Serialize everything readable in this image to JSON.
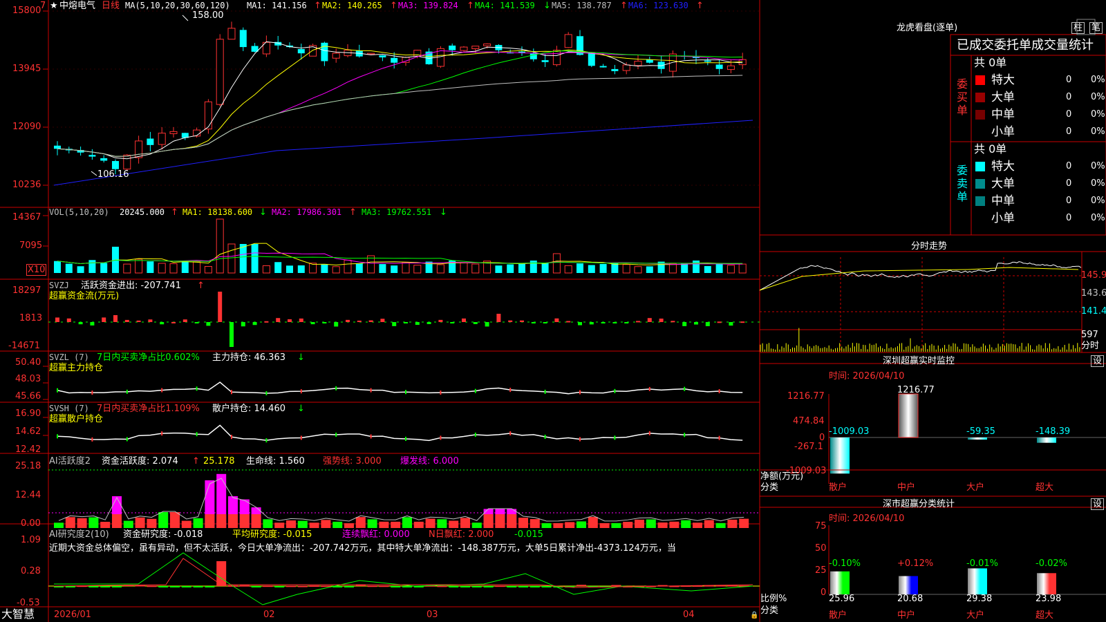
{
  "app": {
    "stock_name": "中熔电气",
    "period": "日线",
    "bottom_label": "大智慧",
    "star_glyph": "★"
  },
  "colors": {
    "up": "#ff3232",
    "down": "#00ffff",
    "ma1": "#ffffff",
    "ma2": "#ffff00",
    "ma3": "#ff00ff",
    "ma4": "#00ff00",
    "ma5": "#c0c0c0",
    "ma6": "#2020ff",
    "grid": "#cc0000",
    "axis_text": "#ff3232"
  },
  "price_panel": {
    "ma_header": "MA(5,10,20,30,60,120)",
    "ma_values": [
      {
        "label": "MA1: 141.156",
        "arrow": "↑"
      },
      {
        "label": "MA2: 140.265",
        "arrow": "↑"
      },
      {
        "label": "MA3: 139.824",
        "arrow": "↑"
      },
      {
        "label": "MA4: 141.539",
        "arrow": "↓"
      },
      {
        "label": "MA5: 138.787",
        "arrow": "↑"
      },
      {
        "label": "MA6: 123.630",
        "arrow": "↑"
      }
    ],
    "y_ticks": [
      "15800",
      "13945",
      "12090",
      "10236"
    ],
    "high_label": "158.00",
    "low_label": "106.16",
    "top_mark": "7"
  },
  "vol_panel": {
    "header": "VOL(5,10,20)",
    "value": "20245.000",
    "ma_values": [
      {
        "label": "MA1: 18138.600",
        "arrow": "↓"
      },
      {
        "label": "MA2: 17986.301",
        "arrow": "↑"
      },
      {
        "label": "MA3: 19762.551",
        "arrow": "↓"
      }
    ],
    "y_ticks": [
      "14367",
      "7095"
    ],
    "unit": "X10"
  },
  "svzj_panel": {
    "header": "SVZJ",
    "title": "活跃资金进出: -207.741",
    "arrow": "↑",
    "subtitle": "超赢资金流(万元)",
    "y_ticks": [
      "18297",
      "1813",
      "-14671"
    ]
  },
  "svzl_panel": {
    "header": "SVZL (7)",
    "ratio": "7日内买卖净占比0.602%",
    "hold": "主力持仓: 46.363",
    "arrow": "↓",
    "subtitle": "超赢主力持仓",
    "y_ticks": [
      "50.40",
      "48.03",
      "45.66"
    ]
  },
  "svsh_panel": {
    "header": "SVSH (7)",
    "ratio": "7日内买卖净占比1.109%",
    "hold": "散户持仓: 14.460",
    "arrow": "↓",
    "subtitle": "超赢散户持仓",
    "y_ticks": [
      "16.90",
      "14.62",
      "12.42"
    ]
  },
  "ai_active_panel": {
    "header": "AI活跃度2",
    "v1": "资金活跃度: 2.074",
    "v2": "25.178",
    "v3": "生命线: 1.560",
    "v4": "强势线: 3.000",
    "v5": "爆发线: 6.000",
    "y_ticks": [
      "25.18",
      "12.44",
      "0.00"
    ]
  },
  "ai_research_panel": {
    "header": "AI研究度2(10)",
    "v1": "资金研究度: -0.018",
    "v2": "平均研究度: -0.015",
    "v3": "连续飘红: 0.000",
    "v4": "N日飘红: 2.000",
    "v5": "-0.015",
    "text": "近期大资金总体偏空，虽有异动，但不太活跃，今日大单净流出：-207.742万元，其中特大单净流出：-148.387万元，大单5日累计净出-4373.124万元，当",
    "y_ticks": [
      "1.09",
      "0.28",
      "-0.53"
    ]
  },
  "date_axis": [
    "2026/01",
    "02",
    "03",
    "04"
  ],
  "dragon_panel": {
    "title": "龙虎看盘(逐单)",
    "tabs": [
      "柱",
      "笔"
    ],
    "tab_strip": "已成交委托单成交量统计",
    "buy_label": "委买单",
    "sell_label": "委卖单",
    "buy_total": "共 0单",
    "sell_total": "共 0单",
    "buy_rows": [
      {
        "name": "特大",
        "count": "0",
        "pct": "0%",
        "color": "#ff0000"
      },
      {
        "name": "大单",
        "count": "0",
        "pct": "0%",
        "color": "#990000"
      },
      {
        "name": "中单",
        "count": "0",
        "pct": "0%",
        "color": "#770000"
      },
      {
        "name": "小单",
        "count": "0",
        "pct": "0%",
        "color": "#000000"
      }
    ],
    "sell_rows": [
      {
        "name": "特大",
        "count": "0",
        "pct": "0%",
        "color": "#00ffff"
      },
      {
        "name": "大单",
        "count": "0",
        "pct": "0%",
        "color": "#008b8b"
      },
      {
        "name": "中单",
        "count": "0",
        "pct": "0%",
        "color": "#008080"
      },
      {
        "name": "小单",
        "count": "0",
        "pct": "0%",
        "color": "#000000"
      }
    ]
  },
  "intraday_panel": {
    "title": "分时走势",
    "y_ticks": [
      "145.9",
      "143.6",
      "141.4"
    ],
    "vol_tick": "597",
    "vol_label": "分时"
  },
  "monitor_panel": {
    "title": "深圳超赢实时监控",
    "settings": "设",
    "time": "时间: 2026/04/10",
    "y_ticks": [
      "1216.77",
      "474.84",
      "0",
      "-267.1",
      "-1009.03"
    ],
    "y_label": "净额(万元)",
    "x_label": "分类",
    "categories": [
      "散户",
      "中户",
      "大户",
      "超大"
    ],
    "values": [
      -1009.03,
      1216.77,
      -59.35,
      -148.39
    ],
    "value_labels": [
      "-1009.03",
      "1216.77",
      "-59.35",
      "-148.39"
    ]
  },
  "class_panel": {
    "title": "深市超赢分类统计",
    "settings": "设",
    "time": "时间: 2026/04/10",
    "y_ticks": [
      "75",
      "50",
      "25",
      "0"
    ],
    "y_label": "比例%",
    "x_label": "分类",
    "categories": [
      "散户",
      "中户",
      "大户",
      "超大"
    ],
    "values": [
      25.96,
      20.68,
      29.38,
      23.98
    ],
    "value_labels": [
      "25.96",
      "20.68",
      "29.38",
      "23.98"
    ],
    "changes": [
      "-0.10%",
      "+0.12%",
      "-0.01%",
      "-0.02%"
    ]
  }
}
